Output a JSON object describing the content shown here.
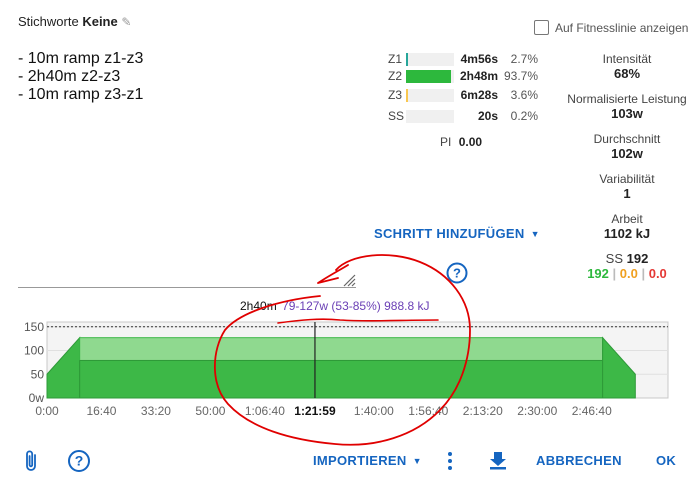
{
  "header": {
    "keywords_label": "Stichworte",
    "keywords_value": "Keine",
    "fitness_checkbox_label": "Auf Fitnesslinie anzeigen"
  },
  "description_lines": [
    "- 10m ramp z1-z3",
    "- 2h40m z2-z3",
    "- 10m ramp z3-z1"
  ],
  "zones": [
    {
      "label": "Z1",
      "time": "4m56s",
      "pct": "2.7%",
      "fraction": 0.027,
      "color": "#26a69a"
    },
    {
      "label": "Z2",
      "time": "2h48m",
      "pct": "93.7%",
      "fraction": 0.937,
      "color": "#2db83d"
    },
    {
      "label": "Z3",
      "time": "6m28s",
      "pct": "3.6%",
      "fraction": 0.036,
      "color": "#f9c74f"
    },
    {
      "label": "SS",
      "time": "20s",
      "pct": "0.2%",
      "fraction": 0.002,
      "color": "#ffffff"
    }
  ],
  "pi": {
    "label": "PI",
    "value": "0.00"
  },
  "stats": {
    "intensity_label": "Intensität",
    "intensity_value": "68%",
    "np_label": "Normalisierte Leistung",
    "np_value": "103w",
    "avg_label": "Durchschnitt",
    "avg_value": "102w",
    "var_label": "Variabilität",
    "var_value": "1",
    "work_label": "Arbeit",
    "work_value": "1102 kJ",
    "ss_label": "SS",
    "ss_value": "192",
    "ss_split": [
      "192",
      "0.0",
      "0.0"
    ],
    "ss_split_colors": [
      "#2db83d",
      "#f0a020",
      "#e53935"
    ]
  },
  "add_step_label": "SCHRITT HINZUFÜGEN",
  "hover_info": {
    "duration": "2h40m",
    "range": "79-127w (53-85%) 988.8 kJ"
  },
  "chart_data": {
    "type": "area",
    "title": "",
    "xlabel": "",
    "ylabel": "",
    "ylim": [
      0,
      160
    ],
    "yticks": [
      "150",
      "100",
      "50",
      "0w"
    ],
    "ytick_values": [
      150,
      100,
      50,
      0
    ],
    "xticks": [
      "0:00",
      "16:40",
      "33:20",
      "50:00",
      "1:06:40",
      "1:21:59",
      "1:40:00",
      "1:56:40",
      "2:13:20",
      "2:30:00",
      "2:46:40"
    ],
    "xtick_values": [
      0,
      1000,
      2000,
      3000,
      4000,
      4919,
      6000,
      7000,
      8000,
      9000,
      10000
    ],
    "xlim": [
      0,
      11400
    ],
    "highlight_xtick": "1:21:59",
    "threshold_line": 150,
    "steps": [
      {
        "start": 0,
        "end": 600,
        "from": 50,
        "to": 127,
        "ramp": true
      },
      {
        "start": 600,
        "end": 10200,
        "low": 79,
        "high": 127
      },
      {
        "start": 10200,
        "end": 10800,
        "from": 127,
        "to": 50,
        "ramp": true
      }
    ],
    "cursor_x": 4919
  },
  "footer": {
    "import_label": "IMPORTIEREN",
    "cancel_label": "ABBRECHEN",
    "ok_label": "OK"
  }
}
